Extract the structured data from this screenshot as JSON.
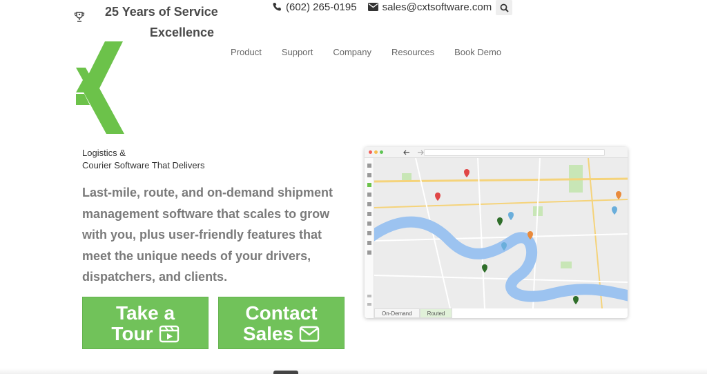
{
  "header": {
    "tagline_line1": "25 Years of Service",
    "tagline_line2": "Excellence",
    "phone": "(602) 265-0195",
    "email": "sales@cxtsoftware.com"
  },
  "nav": {
    "items": [
      "Product",
      "Support",
      "Company",
      "Resources",
      "Book Demo"
    ]
  },
  "hero": {
    "subtitle_line1": "Logistics &",
    "subtitle_line2": "Courier Software That Delivers",
    "lead": "Last-mile, route, and on-demand shipment management software that scales to grow with you, plus user-friendly features that meet the unique needs of your drivers, dispatchers, and clients.",
    "tour_line1": "Take a",
    "tour_line2": "Tour",
    "contact_line1": "Contact",
    "contact_line2": "Sales"
  },
  "map": {
    "tabs": [
      "On-Demand",
      "Routed"
    ],
    "active_tab": "Routed"
  },
  "colors": {
    "brand_green": "#71c25a",
    "river_blue": "#9cc3f0"
  }
}
